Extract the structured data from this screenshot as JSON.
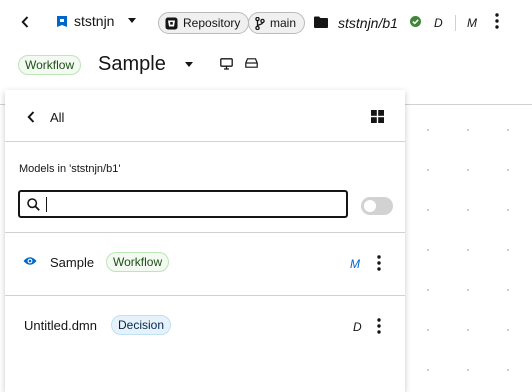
{
  "topbar": {
    "repo_name": "ststnjn",
    "repository_label": "Repository",
    "branch_label": "main",
    "file_path": "ststnjn/b1",
    "status_d": "D",
    "status_m": "M"
  },
  "editor": {
    "type_badge": "Workflow",
    "title": "Sample"
  },
  "panel": {
    "back_label": "All",
    "models_title": "Models in 'ststnjn/b1'",
    "search": {
      "value": "",
      "placeholder": ""
    },
    "items": [
      {
        "name": "Sample",
        "type": "Workflow",
        "flag": "M"
      },
      {
        "name": "Untitled.dmn",
        "type": "Decision",
        "flag": "D"
      }
    ]
  },
  "colors": {
    "accent": "#0066cc",
    "success": "#3e8635",
    "workflow_badge_bg": "#f3faf2",
    "decision_badge_bg": "#e7f1fa"
  }
}
